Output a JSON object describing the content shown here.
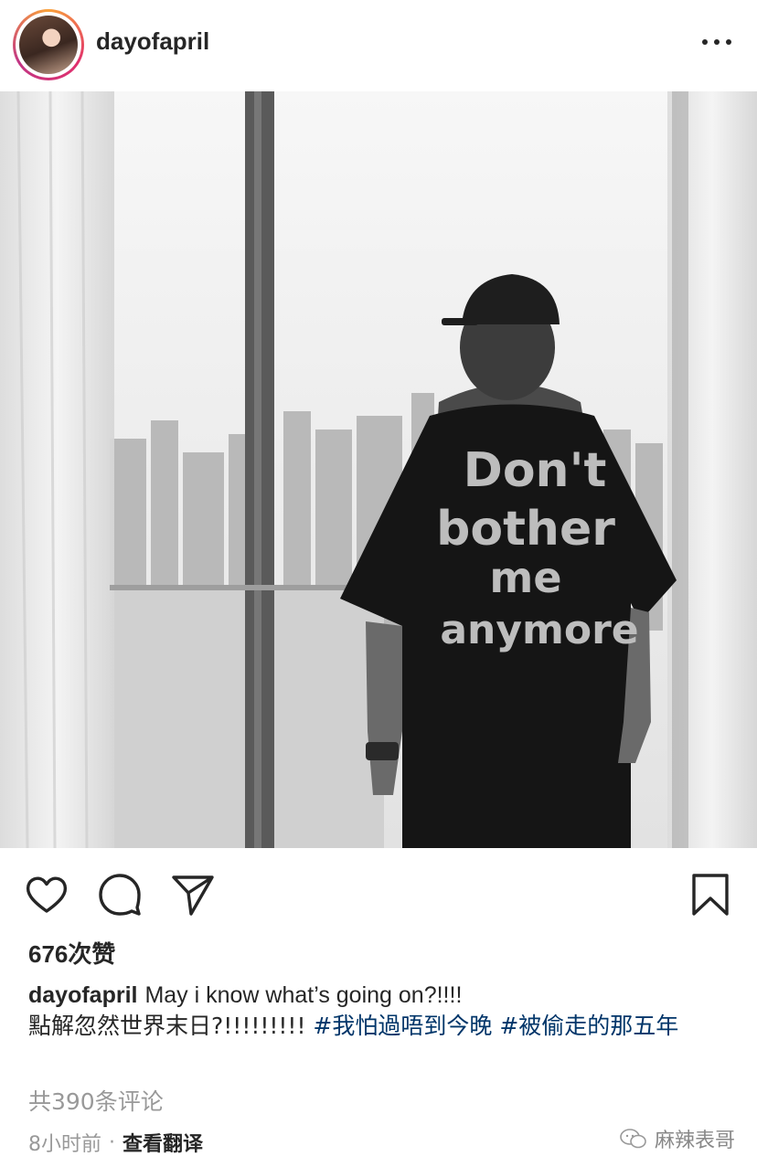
{
  "header": {
    "username": "dayofapril",
    "avatar_icon": "profile-photo",
    "more_icon": "more-options-icon"
  },
  "photo": {
    "shirt_text": [
      "Don't",
      "bother",
      "me",
      "anymore"
    ]
  },
  "actions": {
    "like_icon": "heart-icon",
    "comment_icon": "comment-bubble-icon",
    "share_icon": "paper-plane-icon",
    "save_icon": "bookmark-icon"
  },
  "likes": "676次赞",
  "caption": {
    "username": "dayofapril",
    "text_line1": "May i know what’s going on?!!!!",
    "text_line2": "點解忽然世界末日?!!!!!!!!!",
    "hashtags": [
      "#我怕過唔到今晚",
      "#被偷走的那五年"
    ]
  },
  "comments_link": "共390条评论",
  "footer": {
    "time": "8小时前",
    "separator": "·",
    "translate": "查看翻译"
  },
  "watermark": {
    "text": "麻辣表哥"
  },
  "colors": {
    "text": "#262626",
    "muted": "#999999",
    "hashtag": "#003569"
  }
}
